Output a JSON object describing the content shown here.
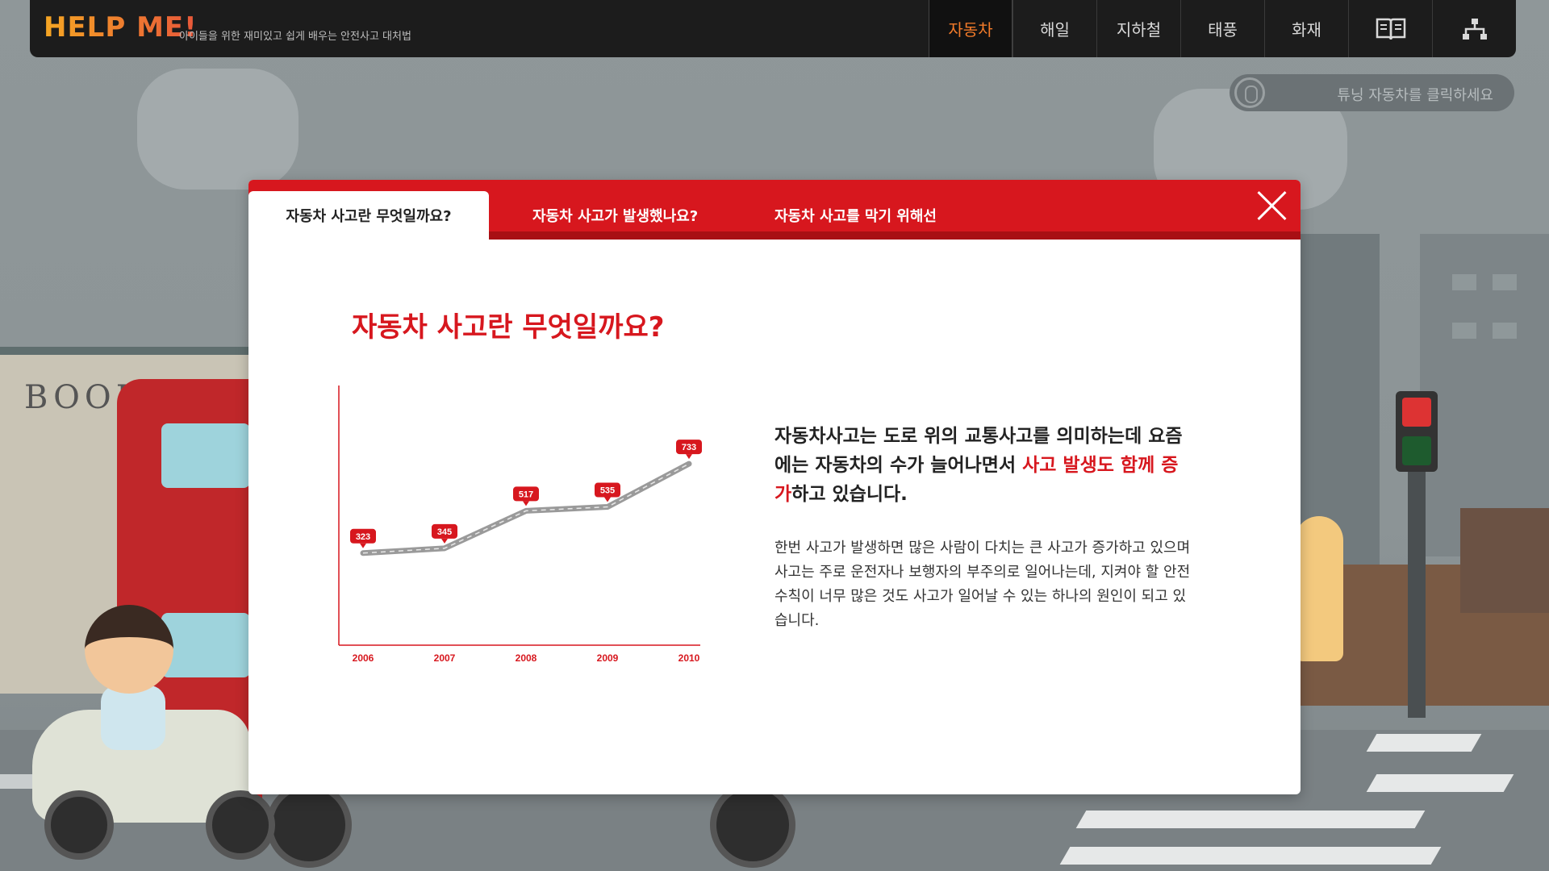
{
  "app": {
    "logo": "HELP ME!",
    "tagline": "아이들을 위한 재미있고 쉽게 배우는 안전사고 대처법"
  },
  "nav": {
    "items": [
      {
        "label": "자동차",
        "active": true
      },
      {
        "label": "해일",
        "active": false
      },
      {
        "label": "지하철",
        "active": false
      },
      {
        "label": "태풍",
        "active": false
      },
      {
        "label": "화재",
        "active": false
      }
    ],
    "book_icon": "book-icon",
    "sitemap_icon": "sitemap-icon"
  },
  "hint": {
    "text": "튜닝 자동차를 클릭하세요",
    "icon": "mouse-icon"
  },
  "background": {
    "shop_sign": "BOOK"
  },
  "modal": {
    "tabs": [
      {
        "label": "자동차 사고란 무엇일까요?",
        "active": true
      },
      {
        "label": "자동차 사고가 발생했나요?",
        "active": false
      },
      {
        "label": "자동차 사고를 막기 위해선",
        "active": false
      }
    ],
    "close_icon": "close-icon",
    "title": "자동차 사고란 무엇일까요?",
    "lead_part1": "자동차사고는 도로 위의 교통사고를 의미하는데 요즘에는 자동차의 수가 늘어나면서 ",
    "lead_highlight": "사고 발생도 함께 증가",
    "lead_part2": "하고 있습니다.",
    "body": "한번 사고가 발생하면 많은 사람이 다치는 큰 사고가 증가하고 있으며 사고는 주로 운전자나 보행자의 부주의로 일어나는데, 지켜야 할 안전 수칙이 너무 많은 것도 사고가 일어날 수 있는 하나의 원인이 되고 있습니다."
  },
  "colors": {
    "accent": "#d7171e",
    "accent_dark": "#a80f14",
    "nav_active": "#f37b2a",
    "topbar": "#1c1c1c"
  },
  "chart_data": {
    "type": "line",
    "categories": [
      "2006",
      "2007",
      "2008",
      "2009",
      "2010"
    ],
    "values": [
      323,
      345,
      517,
      535,
      733
    ],
    "ylim": [
      0,
      1000
    ],
    "grid": false
  }
}
